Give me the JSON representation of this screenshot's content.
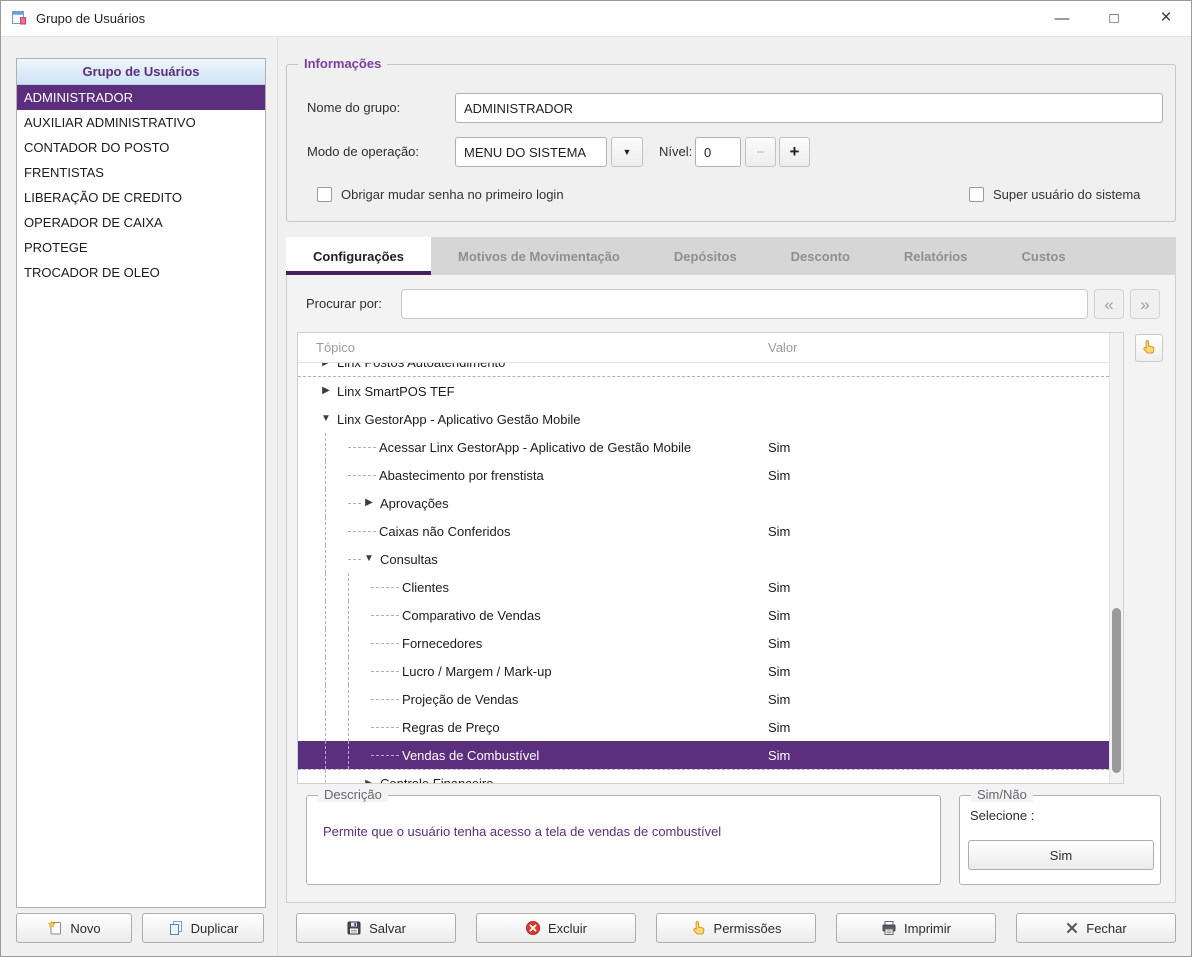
{
  "window": {
    "title": "Grupo de Usuários",
    "minimize": "—",
    "maximize": "□",
    "close": "×"
  },
  "colors": {
    "accent": "#5C2E7E",
    "caption": "#7B3FA2",
    "tab_underline": "#46215E"
  },
  "left_panel": {
    "header": "Grupo de Usuários",
    "items": [
      {
        "label": "ADMINISTRADOR",
        "selected": true
      },
      {
        "label": "AUXILIAR ADMINISTRATIVO",
        "selected": false
      },
      {
        "label": "CONTADOR DO POSTO",
        "selected": false
      },
      {
        "label": "FRENTISTAS",
        "selected": false
      },
      {
        "label": "LIBERAÇÃO DE CREDITO",
        "selected": false
      },
      {
        "label": "OPERADOR DE CAIXA",
        "selected": false
      },
      {
        "label": "PROTEGE",
        "selected": false
      },
      {
        "label": "TROCADOR DE OLEO",
        "selected": false
      }
    ],
    "buttons": [
      {
        "label": "Novo",
        "icon": "new-icon"
      },
      {
        "label": "Duplicar",
        "icon": "copy-icon"
      }
    ]
  },
  "info": {
    "caption": "Informações",
    "nome_label": "Nome do grupo:",
    "nome_value": "ADMINISTRADOR",
    "modo_label": "Modo de operação:",
    "modo_value": "MENU DO SISTEMA",
    "dropdown_icon": "dropdown-arrow-icon",
    "nivel_label": "Nível:",
    "nivel_value": "0",
    "nivel_minus": "−",
    "nivel_plus": "+",
    "checkbox_senha": "Obrigar mudar senha no primeiro login",
    "checkbox_super": "Super usuário do sistema"
  },
  "tabs": [
    {
      "label": "Configurações",
      "active": true
    },
    {
      "label": "Motivos de Movimentação",
      "active": false
    },
    {
      "label": "Depósitos",
      "active": false
    },
    {
      "label": "Desconto",
      "active": false
    },
    {
      "label": "Relatórios",
      "active": false
    },
    {
      "label": "Custos",
      "active": false
    }
  ],
  "search": {
    "label": "Procurar por:",
    "value": "",
    "prev_icon": "nav-prev-icon",
    "next_icon": "nav-next-icon",
    "options_icon": "hand-icon"
  },
  "tree": {
    "columns": [
      "Tópico",
      "Valor"
    ],
    "rows": [
      {
        "label": "Linx Postos Autoatendimento",
        "level": 0,
        "expander": "collapsed",
        "clipped_top": true
      },
      {
        "label": "Linx SmartPOS TEF",
        "level": 0,
        "expander": "collapsed"
      },
      {
        "label": "Linx GestorApp - Aplicativo Gestão Mobile",
        "level": 0,
        "expander": "expanded"
      },
      {
        "label": "Acessar Linx GestorApp - Aplicativo de Gestão Mobile",
        "level": 1,
        "value": "Sim"
      },
      {
        "label": "Abastecimento por frenstista",
        "level": 1,
        "value": "Sim"
      },
      {
        "label": "Aprovações",
        "level": 1,
        "expander": "collapsed"
      },
      {
        "label": "Caixas não Conferidos",
        "level": 1,
        "value": "Sim"
      },
      {
        "label": "Consultas",
        "level": 1,
        "expander": "expanded"
      },
      {
        "label": "Clientes",
        "level": 2,
        "value": "Sim"
      },
      {
        "label": "Comparativo de Vendas",
        "level": 2,
        "value": "Sim"
      },
      {
        "label": "Fornecedores",
        "level": 2,
        "value": "Sim"
      },
      {
        "label": "Lucro / Margem / Mark-up",
        "level": 2,
        "value": "Sim"
      },
      {
        "label": "Projeção de Vendas",
        "level": 2,
        "value": "Sim"
      },
      {
        "label": "Regras de Preço",
        "level": 2,
        "value": "Sim"
      },
      {
        "label": "Vendas de Combustível",
        "level": 2,
        "value": "Sim",
        "selected": true
      },
      {
        "label": "Controle Financeiro",
        "level": 1,
        "expander": "collapsed",
        "clipped_bottom": true
      }
    ]
  },
  "descricao": {
    "caption": "Descrição",
    "text": "Permite que o usuário tenha acesso a tela de vendas de combustível"
  },
  "sim_nao": {
    "caption": "Sim/Não",
    "label": "Selecione :",
    "button_label": "Sim"
  },
  "actions": [
    {
      "label": "Salvar",
      "icon": "save-icon"
    },
    {
      "label": "Excluir",
      "icon": "delete-icon"
    },
    {
      "label": "Permissões",
      "icon": "hand-icon"
    },
    {
      "label": "Imprimir",
      "icon": "printer-icon"
    },
    {
      "label": "Fechar",
      "icon": "close-icon"
    }
  ]
}
